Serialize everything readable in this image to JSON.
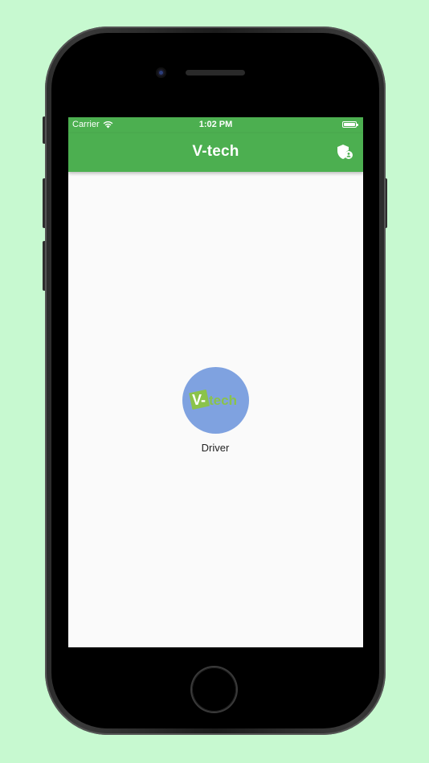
{
  "status_bar": {
    "carrier": "Carrier",
    "time": "1:02 PM"
  },
  "app_bar": {
    "title": "V-tech",
    "action_icon": "admin-shield-icon"
  },
  "role_option": {
    "label": "Driver",
    "logo_text_prefix": "V-",
    "logo_text_suffix": "tech"
  },
  "colors": {
    "background": "#c7f9d0",
    "primary": "#4caf50",
    "avatar": "#7fa2e0",
    "logo_green": "#8bc34a"
  }
}
